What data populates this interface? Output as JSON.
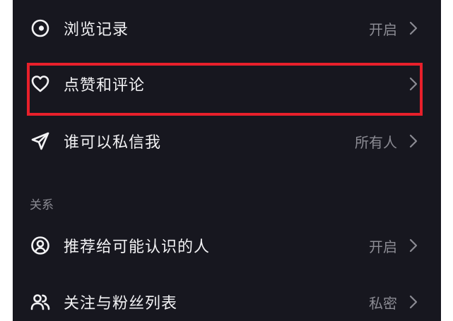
{
  "settings": {
    "rows": [
      {
        "label": "浏览记录",
        "value": "开启",
        "icon": "eye-icon"
      },
      {
        "label": "点赞和评论",
        "value": "",
        "icon": "heart-icon"
      },
      {
        "label": "谁可以私信我",
        "value": "所有人",
        "icon": "send-icon"
      },
      {
        "label": "推荐给可能认识的人",
        "value": "开启",
        "icon": "user-circle-icon"
      },
      {
        "label": "关注与粉丝列表",
        "value": "私密",
        "icon": "users-icon"
      }
    ],
    "section_relations": "关系"
  },
  "colors": {
    "background": "#17171f",
    "text": "#f2f2f4",
    "muted": "#8b8b93",
    "highlight": "#e8202b"
  }
}
